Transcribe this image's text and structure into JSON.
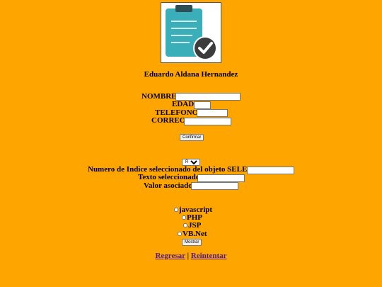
{
  "header": {
    "author_name": "Eduardo Aldana Hernandez"
  },
  "form": {
    "nombre_label": "NOMBRE",
    "edad_label": "EDAD",
    "telefono_label": "TELEFONO",
    "correo_label": "CORREO",
    "nombre_value": "",
    "edad_value": "",
    "telefono_value": "",
    "correo_value": "",
    "confirm_button": "Confirmar"
  },
  "select_section": {
    "selected_option": "Rojo",
    "index_label": "Numero de Indice seleccionado del objeto SELECT:",
    "text_label": "Texto seleccionado:",
    "value_label": "Valor asociado:",
    "index_value": "",
    "text_value": "",
    "value_value": ""
  },
  "checkboxes": {
    "items": [
      "javascript",
      "PHP",
      "JSP",
      "VB.Net"
    ],
    "show_button": "Mostrar"
  },
  "links": {
    "back": "Regresar",
    "separator": "|",
    "retry": "Reintentar"
  },
  "colors": {
    "background": "#FFA500",
    "clipboard": "#3AAFB9",
    "check_circle": "#3C3C3C"
  },
  "icons": {
    "logo": "clipboard-check-icon"
  }
}
